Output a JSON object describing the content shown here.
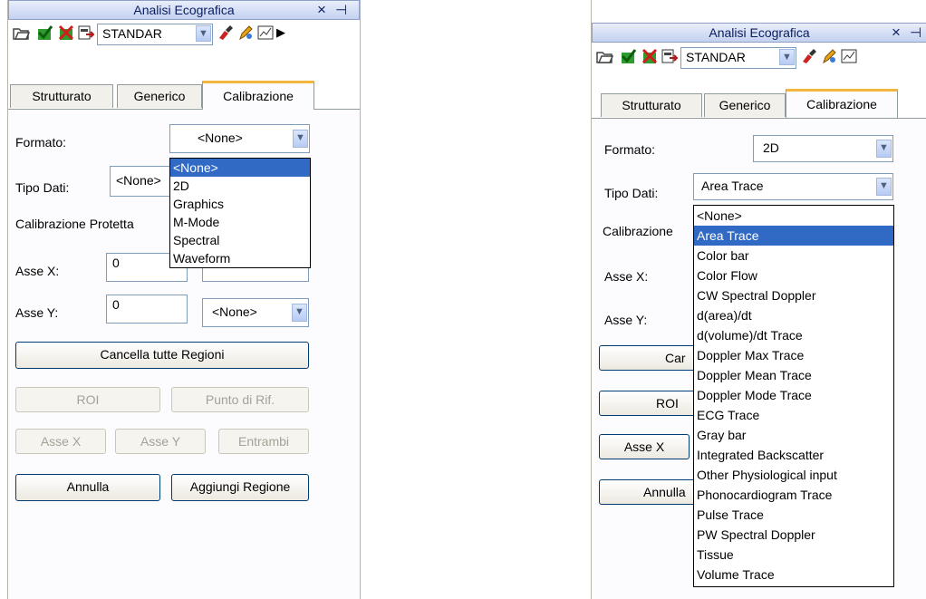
{
  "left": {
    "title": "Analisi Ecografica",
    "close": "×",
    "pin": "⊣",
    "preset": "STANDAR",
    "tabs": [
      "Strutturato",
      "Generico",
      "Calibrazione"
    ],
    "formato_label": "Formato:",
    "formato_value": "<None>",
    "tipo_label": "Tipo Dati:",
    "tipo_value": "<None>",
    "calibrazione_label": "Calibrazione Protetta",
    "assex_label": "Asse X:",
    "assex_value": "0",
    "assey_label": "Asse Y:",
    "assey_value": "0",
    "assey_unit": "<None>",
    "btn_cancella": "Cancella tutte Regioni",
    "btn_roi": "ROI",
    "btn_punto": "Punto di Rif.",
    "btn_assex": "Asse X",
    "btn_assey": "Asse Y",
    "btn_entrambi": "Entrambi",
    "btn_annulla": "Annulla",
    "btn_aggiungi": "Aggiungi Regione",
    "dropdown": [
      "<None>",
      "2D",
      "Graphics",
      "M-Mode",
      "Spectral",
      "Waveform"
    ]
  },
  "right": {
    "title": "Analisi Ecografica",
    "close": "×",
    "pin": "⊣",
    "preset": "STANDAR",
    "tabs": [
      "Strutturato",
      "Generico",
      "Calibrazione"
    ],
    "formato_label": "Formato:",
    "formato_value": "2D",
    "tipo_label": "Tipo Dati:",
    "tipo_value": "Area Trace",
    "calibrazione_label": "Calibrazione",
    "assex_label": "Asse X:",
    "assey_label": "Asse Y:",
    "btn_cancella": "Car",
    "btn_roi": "ROI",
    "btn_assex": "Asse X",
    "btn_annulla": "Annulla",
    "dropdown": [
      "<None>",
      "Area Trace",
      "Color bar",
      "Color Flow",
      "CW Spectral Doppler",
      "d(area)/dt",
      "d(volume)/dt Trace",
      "Doppler Max Trace",
      "Doppler Mean Trace",
      "Doppler Mode Trace",
      "ECG Trace",
      "Gray bar",
      "Integrated Backscatter",
      "Other Physiological input",
      "Phonocardiogram Trace",
      "Pulse Trace",
      "PW Spectral Doppler",
      "Tissue",
      "Volume Trace"
    ]
  },
  "icons": {
    "open": "folder-open-icon",
    "save": "check-save-icon",
    "delete": "delete-icon",
    "export": "export-icon",
    "settings": "brush-icon",
    "edit": "pen-icon",
    "chart": "chart-icon",
    "more": "more-arrow-icon"
  }
}
